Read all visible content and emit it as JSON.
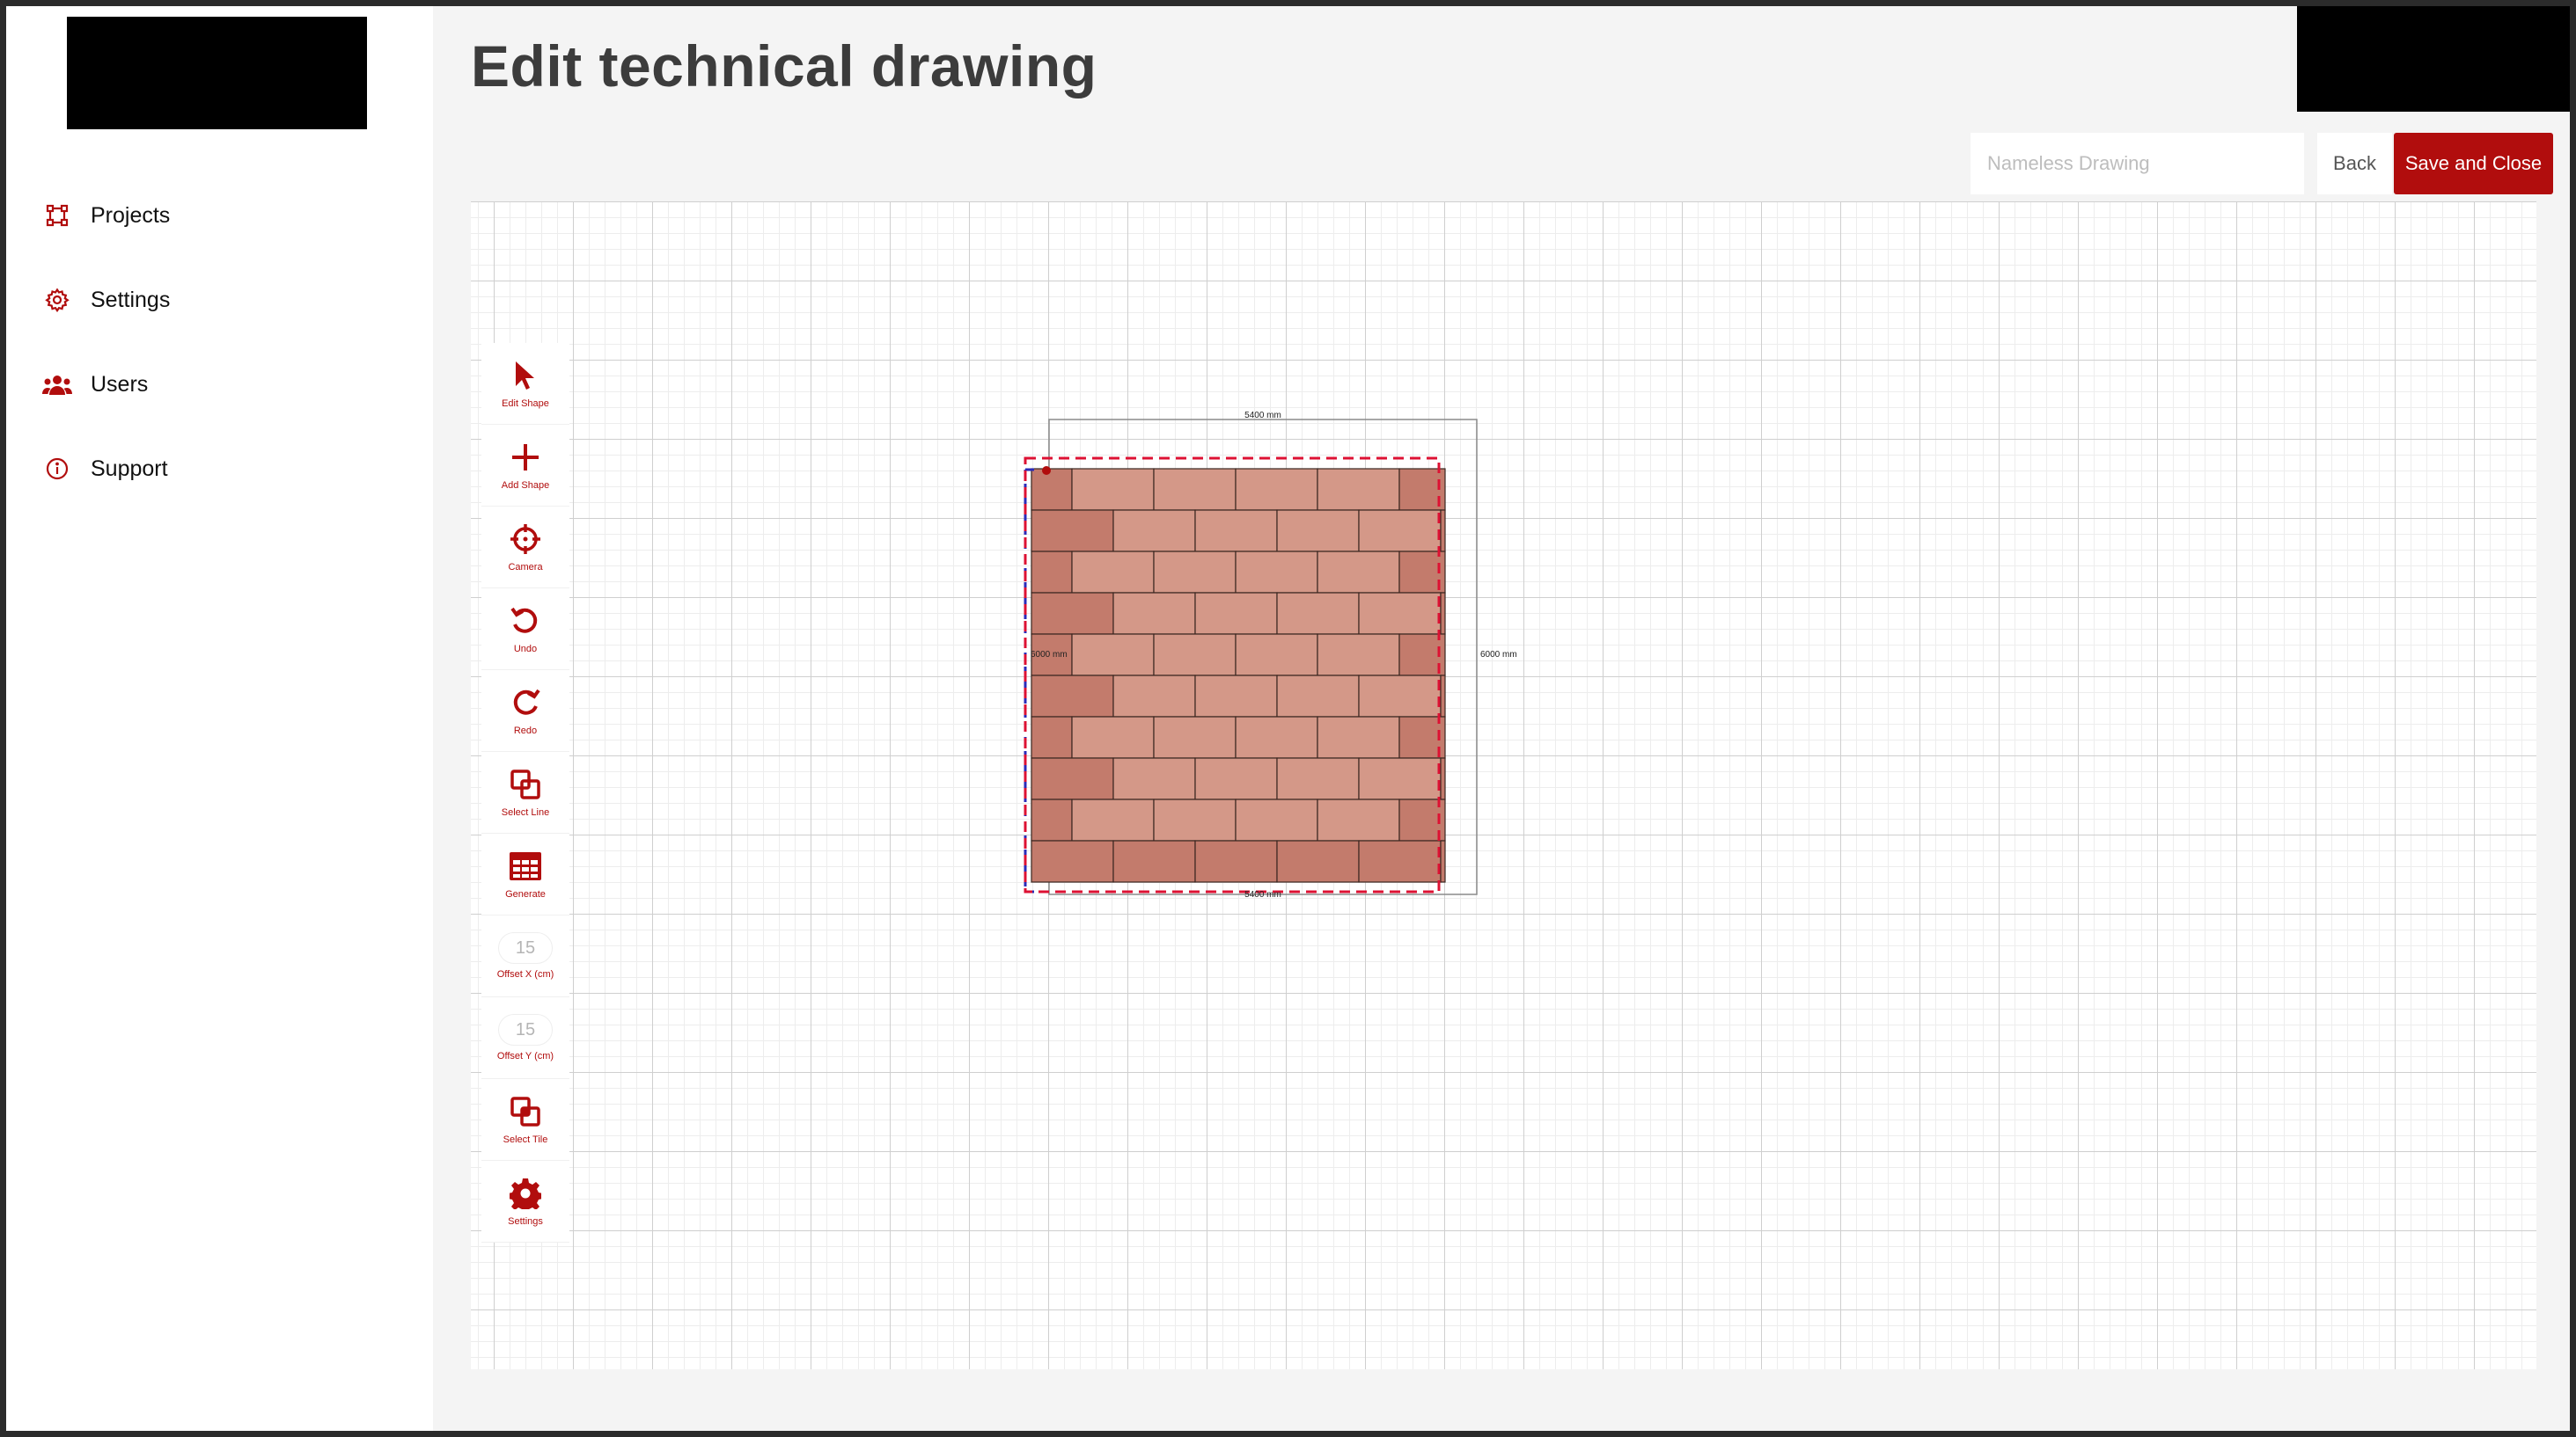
{
  "sidebar": {
    "items": [
      {
        "label": "Projects",
        "icon": "projects-icon"
      },
      {
        "label": "Settings",
        "icon": "settings-gear-icon"
      },
      {
        "label": "Users",
        "icon": "users-icon"
      },
      {
        "label": "Support",
        "icon": "info-icon"
      }
    ]
  },
  "header": {
    "title": "Edit technical drawing",
    "name_placeholder": "Nameless Drawing",
    "name_value": "",
    "back_label": "Back",
    "save_label": "Save and Close"
  },
  "toolbar": {
    "tools": [
      {
        "label": "Edit Shape",
        "icon": "cursor-arrow-icon"
      },
      {
        "label": "Add Shape",
        "icon": "plus-icon"
      },
      {
        "label": "Camera",
        "icon": "crosshair-icon"
      },
      {
        "label": "Undo",
        "icon": "undo-icon"
      },
      {
        "label": "Redo",
        "icon": "redo-icon"
      },
      {
        "label": "Select Line",
        "icon": "select-line-icon"
      },
      {
        "label": "Generate",
        "icon": "grid-table-icon"
      },
      {
        "label": "Offset X (cm)",
        "value": "15"
      },
      {
        "label": "Offset Y (cm)",
        "value": "15"
      },
      {
        "label": "Select Tile",
        "icon": "select-tile-icon"
      },
      {
        "label": "Settings",
        "icon": "settings-gear-icon"
      }
    ]
  },
  "drawing": {
    "dimensions": {
      "top": "5400 mm",
      "bottom": "5400 mm",
      "left": "6000 mm",
      "right": "6000 mm"
    },
    "pattern": "running-bond brick",
    "rows": 10,
    "colors": {
      "tile": "#d49888",
      "tile_dark": "#c37b6c",
      "accent": "#b10d0d",
      "selection_blue": "#2b2bb8",
      "selection_red": "#dd1133"
    }
  }
}
